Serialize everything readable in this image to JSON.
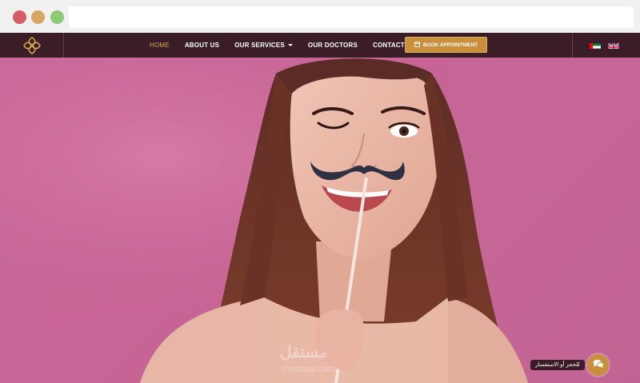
{
  "browser": {
    "buttons": [
      "close",
      "minimize",
      "maximize"
    ]
  },
  "nav": {
    "items": [
      {
        "label": "HOME",
        "active": true
      },
      {
        "label": "ABOUT US"
      },
      {
        "label": "OUR SERVICES",
        "dropdown": true
      },
      {
        "label": "OUR DOCTORS"
      },
      {
        "label": "CONTACT US"
      }
    ],
    "book_label": "BOOK APPOINTMENT"
  },
  "languages": [
    "ar-flag-icon",
    "en-flag-icon"
  ],
  "chat": {
    "label": "للحجز أو الاستفسار",
    "icon": "chat-bubbles-icon"
  },
  "watermark": {
    "logo_text": "مستقل",
    "url": "mostaql.com"
  },
  "colors": {
    "nav_bg": "#3a1d27",
    "accent_gold": "#c98f3b",
    "hero_pink": "#c9699a"
  }
}
